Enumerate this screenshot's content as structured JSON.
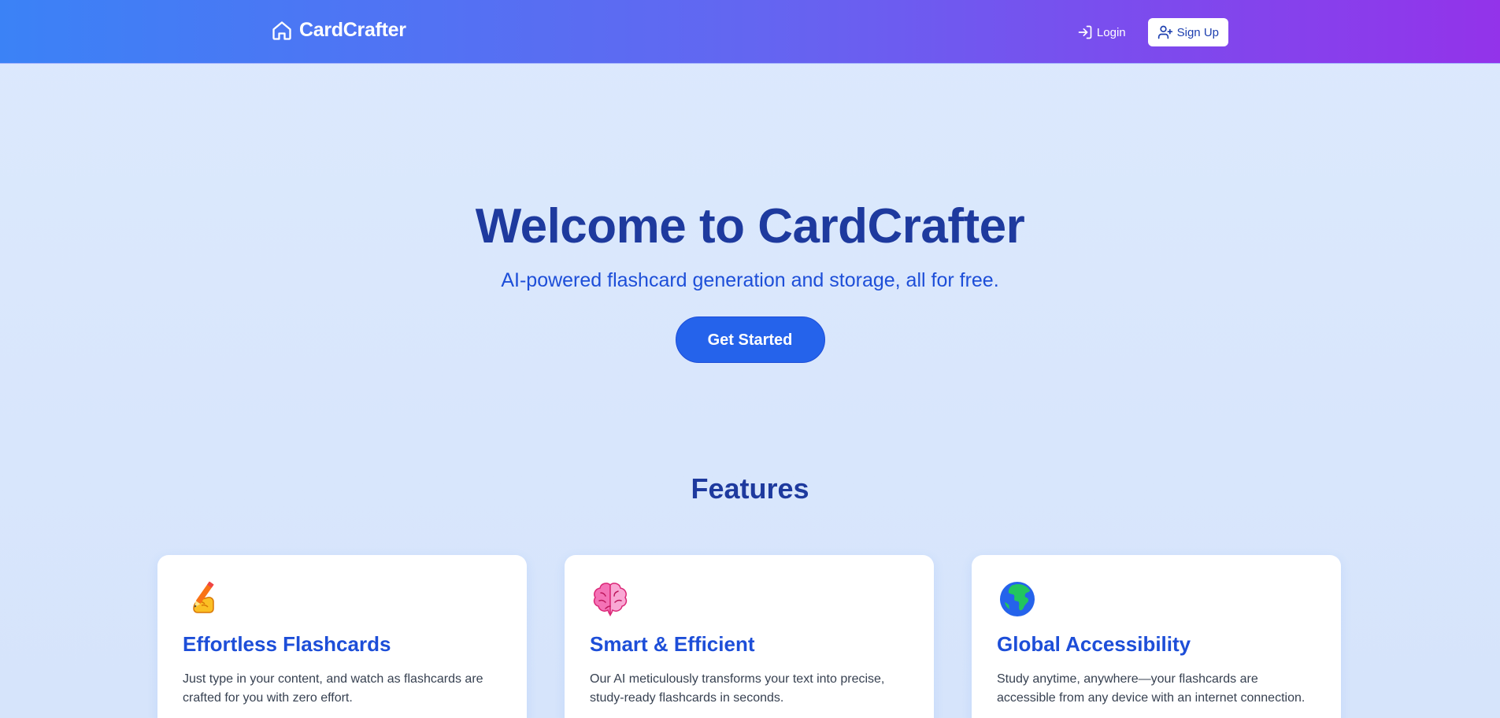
{
  "navbar": {
    "brand": "CardCrafter",
    "brand_icon": "home-icon",
    "login_label": "Login",
    "login_icon": "login-icon",
    "signup_label": "Sign Up",
    "signup_icon": "user-plus-icon",
    "gradient_start": "#3b82f6",
    "gradient_end": "#9333ea"
  },
  "hero": {
    "title": "Welcome to CardCrafter",
    "subtitle": "AI-powered flashcard generation and storage, all for free.",
    "cta_label": "Get Started"
  },
  "features": {
    "title": "Features",
    "cards": [
      {
        "icon": "writing-hand-icon",
        "title": "Effortless Flashcards",
        "text": "Just type in your content, and watch as flashcards are crafted for you with zero effort."
      },
      {
        "icon": "brain-icon",
        "title": "Smart & Efficient",
        "text": "Our AI meticulously transforms your text into precise, study-ready flashcards in seconds."
      },
      {
        "icon": "globe-icon",
        "title": "Global Accessibility",
        "text": "Study anytime, anywhere—your flashcards are accessible from any device with an internet connection."
      }
    ]
  },
  "colors": {
    "accent": "#2563eb",
    "heading": "#1e3a9e",
    "background": "#dce9fd"
  }
}
